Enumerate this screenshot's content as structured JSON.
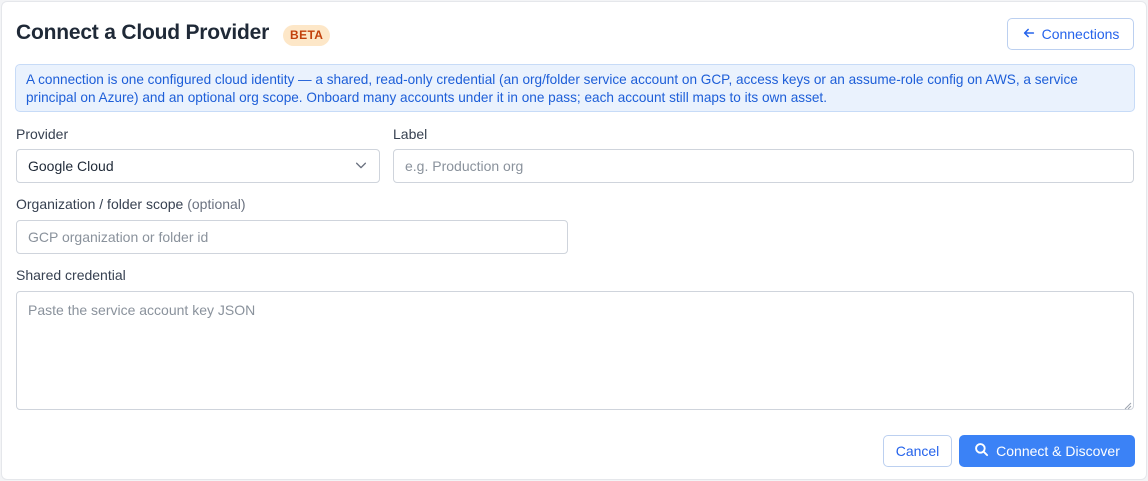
{
  "header": {
    "title": "Connect a Cloud Provider",
    "badge": "BETA",
    "back_button": "Connections"
  },
  "info_text": "A connection is one configured cloud identity — a shared, read-only credential (an org/folder service account on GCP, access keys or an assume-role config on AWS, a service principal on Azure) and an optional org scope. Onboard many accounts under it in one pass; each account still maps to its own asset.",
  "form": {
    "provider": {
      "label": "Provider",
      "value": "Google Cloud"
    },
    "label_field": {
      "label": "Label",
      "placeholder": "e.g. Production org"
    },
    "scope": {
      "label": "Organization / folder scope",
      "optional": "(optional)",
      "placeholder": "GCP organization or folder id"
    },
    "credential": {
      "label": "Shared credential",
      "placeholder": "Paste the service account key JSON"
    }
  },
  "actions": {
    "cancel": "Cancel",
    "submit": "Connect & Discover"
  },
  "colors": {
    "accent": "#3b82f6",
    "link": "#2563eb",
    "badge_bg": "#fde7c8",
    "badge_text": "#c2410c",
    "info_bg": "#eaf2fd"
  },
  "icons": {
    "back": "arrow-left-icon",
    "select": "chevron-down-icon",
    "submit": "search-icon"
  }
}
